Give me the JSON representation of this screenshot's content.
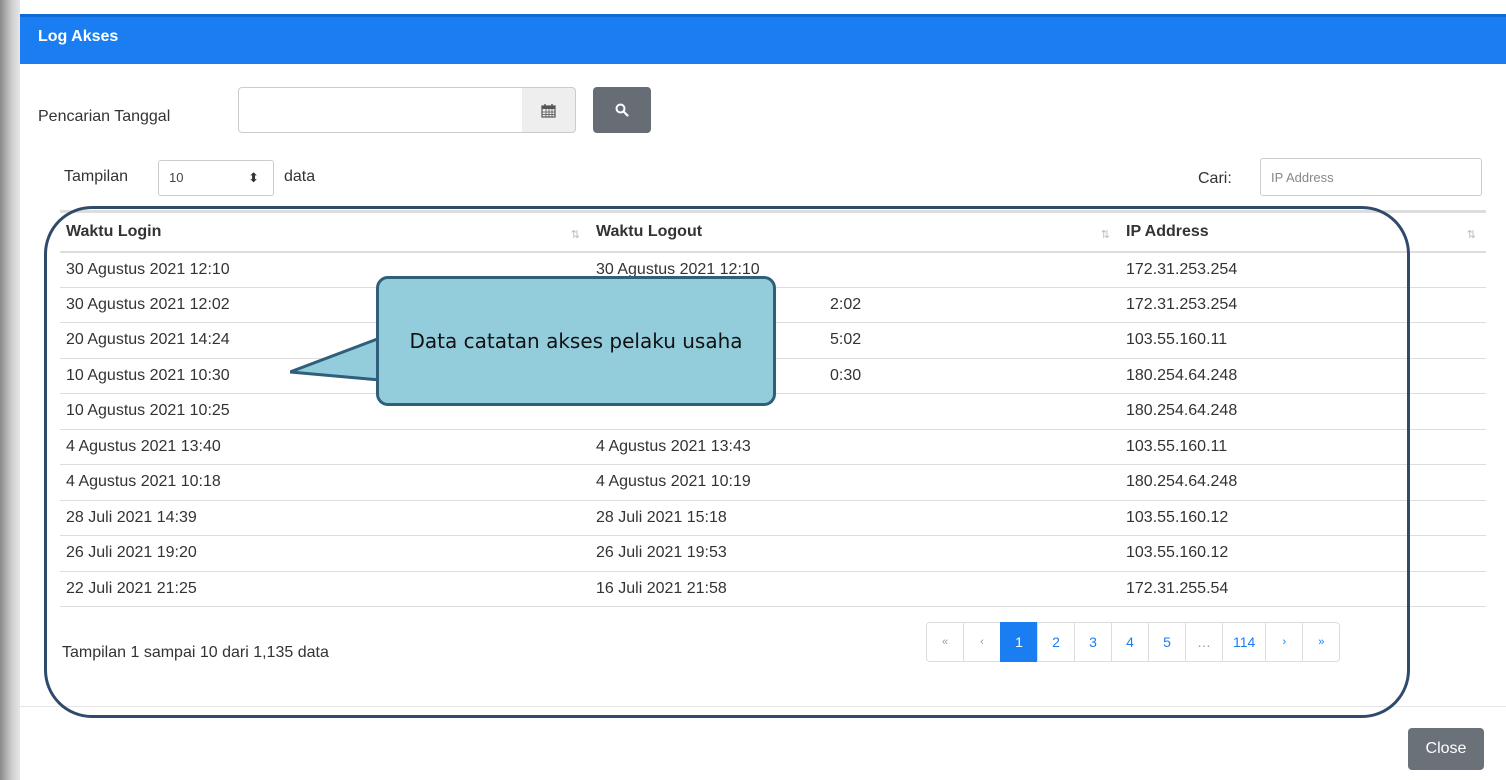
{
  "modal": {
    "title": "Log Akses"
  },
  "search": {
    "date_label": "Pencarian Tanggal",
    "calendar_icon": "calendar-icon",
    "search_icon": "search-icon"
  },
  "length": {
    "prefix": "Tampilan",
    "value": "10",
    "suffix": "data"
  },
  "filter": {
    "label": "Cari:",
    "placeholder": "IP Address"
  },
  "table": {
    "headers": [
      "Waktu Login",
      "Waktu Logout",
      "IP Address"
    ],
    "rows": [
      [
        "30 Agustus 2021 12:10",
        "30 Agustus 2021 12:10",
        "172.31.253.254"
      ],
      [
        "30 Agustus 2021 12:02",
        "2:02",
        "172.31.253.254"
      ],
      [
        "20 Agustus 2021 14:24",
        "5:02",
        "103.55.160.11"
      ],
      [
        "10 Agustus 2021 10:30",
        "0:30",
        "180.254.64.248"
      ],
      [
        "10 Agustus 2021 10:25",
        "",
        "180.254.64.248"
      ],
      [
        "4 Agustus 2021 13:40",
        "4 Agustus 2021 13:43",
        "103.55.160.11"
      ],
      [
        "4 Agustus 2021 10:18",
        "4 Agustus 2021 10:19",
        "180.254.64.248"
      ],
      [
        "28 Juli 2021 14:39",
        "28 Juli 2021 15:18",
        "103.55.160.12"
      ],
      [
        "26 Juli 2021 19:20",
        "26 Juli 2021 19:53",
        "103.55.160.12"
      ],
      [
        "22 Juli 2021 21:25",
        "16 Juli 2021 21:58",
        "172.31.255.54"
      ]
    ]
  },
  "info": "Tampilan 1 sampai 10 dari 1,135 data",
  "pagination": [
    "«",
    "‹",
    "1",
    "2",
    "3",
    "4",
    "5",
    "…",
    "114",
    "›",
    "»"
  ],
  "pagination_active": "1",
  "close_label": "Close",
  "callout": "Data catatan akses pelaku usaha",
  "colors": {
    "header": "#1a7ef2",
    "callout": "#93cddc",
    "highlight": "#2f4a6b"
  }
}
